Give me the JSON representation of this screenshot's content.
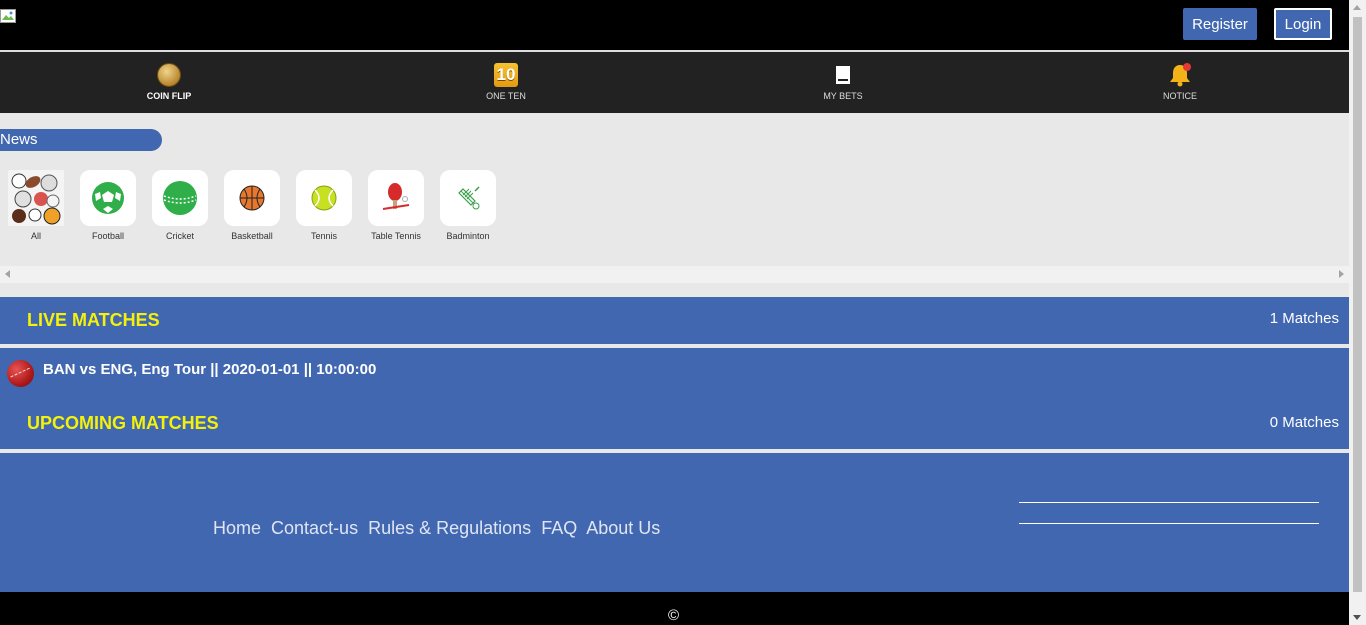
{
  "header": {
    "register_label": "Register",
    "login_label": "Login"
  },
  "nav": {
    "items": [
      {
        "label": "COIN FLIP",
        "icon": "coin-icon"
      },
      {
        "label": "ONE TEN",
        "icon": "one-ten-icon",
        "icon_text": "10"
      },
      {
        "label": "MY BETS",
        "icon": "ticket-icon"
      },
      {
        "label": "NOTICE",
        "icon": "bell-icon"
      }
    ]
  },
  "news": {
    "label": "News"
  },
  "sports": {
    "items": [
      {
        "label": "All",
        "icon": "all-sports-icon"
      },
      {
        "label": "Football",
        "icon": "football-icon"
      },
      {
        "label": "Cricket",
        "icon": "cricket-icon"
      },
      {
        "label": "Basketball",
        "icon": "basketball-icon"
      },
      {
        "label": "Tennis",
        "icon": "tennis-icon"
      },
      {
        "label": "Table Tennis",
        "icon": "table-tennis-icon"
      },
      {
        "label": "Badminton",
        "icon": "badminton-icon"
      }
    ]
  },
  "live": {
    "title": "LIVE MATCHES",
    "count": "1 Matches",
    "matches": [
      {
        "text": "BAN vs ENG, Eng Tour || 2020-01-01 || 10:00:00",
        "icon": "cricket-ball-icon"
      }
    ]
  },
  "upcoming": {
    "title": "UPCOMING MATCHES",
    "count": "0 Matches"
  },
  "footer": {
    "links": [
      "Home",
      "Contact-us",
      "Rules & Regulations",
      "FAQ",
      "About Us"
    ],
    "copyright": "©"
  },
  "colors": {
    "primary": "#4167b1",
    "accent_yellow": "#f4f10a",
    "topbar": "#000000",
    "navbar": "#222222"
  }
}
